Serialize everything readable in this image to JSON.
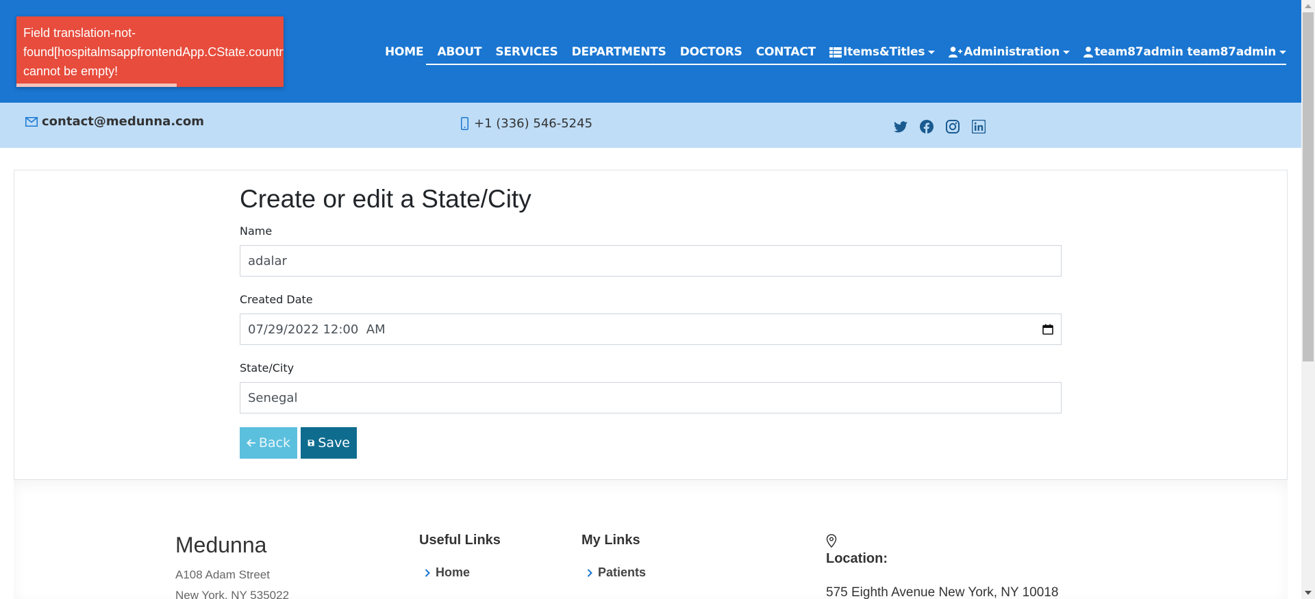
{
  "colors": {
    "header_bg": "#1a76d1",
    "contact_bg": "#bfddf7",
    "toast_bg": "#e74c3c",
    "back_btn": "#5bc0de",
    "save_btn": "#0e6c8f"
  },
  "toast": {
    "line1": "Field translation-not-",
    "line2": "found[hospitalmsappfrontendApp.CState.country]",
    "line3": "cannot be empty!",
    "progress": 0.6
  },
  "nav": {
    "home": "HOME",
    "about": "ABOUT",
    "services": "SERVICES",
    "departments": "DEPARTMENTS",
    "doctors": "DOCTORS",
    "contact": "CONTACT",
    "items_titles": "Items&Titles",
    "administration": "Administration",
    "account": "team87admin team87admin"
  },
  "contact_bar": {
    "email": "contact@medunna.com",
    "phone": "+1 (336) 546-5245",
    "social_icons": [
      "twitter-icon",
      "facebook-icon",
      "instagram-icon",
      "linkedin-icon"
    ]
  },
  "form": {
    "title": "Create or edit a State/City",
    "name_label": "Name",
    "name_value": "adalar",
    "created_label": "Created Date",
    "created_value": "07/29/2022 12:00  AM",
    "state_label": "State/City",
    "state_value": "Senegal",
    "back_label": "Back",
    "save_label": "Save"
  },
  "footer": {
    "brand": "Medunna",
    "address_line1": "A108 Adam Street",
    "address_line2": "New York, NY 535022",
    "useful_links_title": "Useful Links",
    "useful_links": [
      "Home"
    ],
    "my_links_title": "My Links",
    "my_links": [
      "Patients"
    ],
    "location_label": "Location:",
    "location_address": "575 Eighth Avenue New York, NY 10018"
  }
}
